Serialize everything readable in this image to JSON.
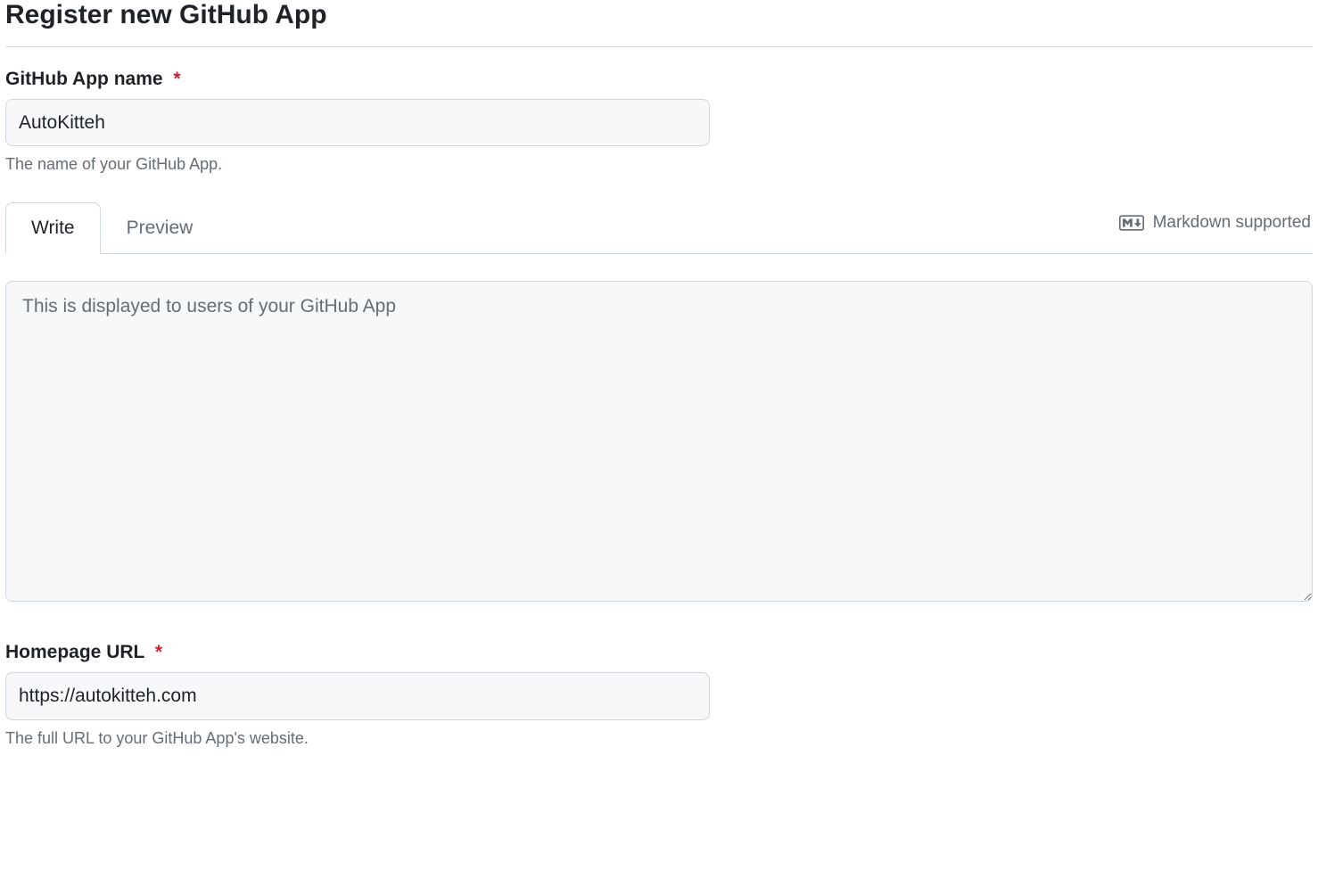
{
  "page": {
    "title": "Register new GitHub App"
  },
  "appName": {
    "label": "GitHub App name",
    "required": "*",
    "value": "AutoKitteh",
    "description": "The name of your GitHub App."
  },
  "tabs": {
    "write": "Write",
    "preview": "Preview"
  },
  "markdown": {
    "label": "Markdown supported"
  },
  "description": {
    "placeholder": "This is displayed to users of your GitHub App",
    "value": ""
  },
  "homepage": {
    "label": "Homepage URL",
    "required": "*",
    "value": "https://autokitteh.com",
    "description": "The full URL to your GitHub App's website."
  }
}
